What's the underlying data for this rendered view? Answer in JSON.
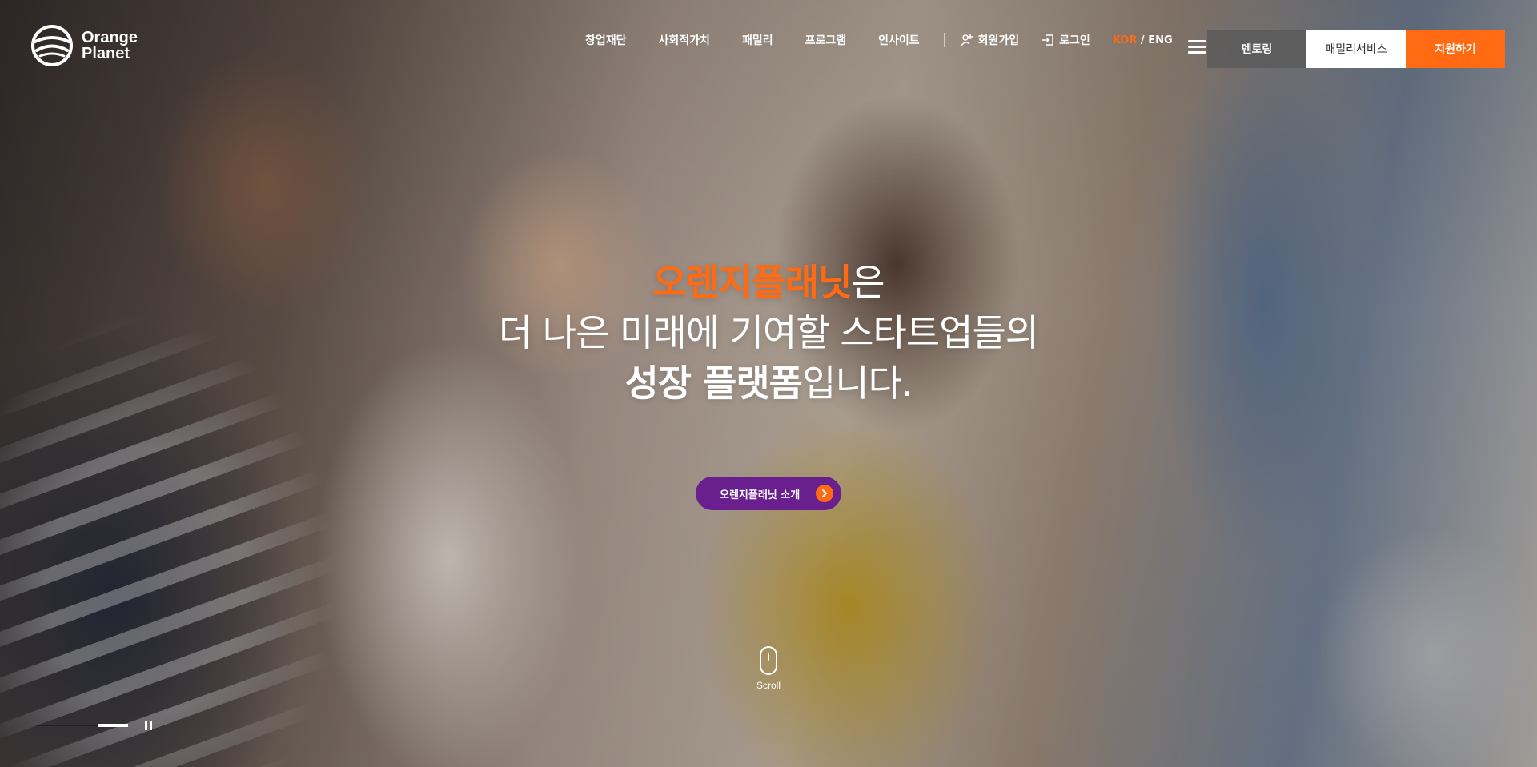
{
  "header": {
    "logo": {
      "line1": "Orange",
      "line2": "Planet"
    },
    "nav": [
      {
        "label": "창업재단"
      },
      {
        "label": "사회적가치"
      },
      {
        "label": "패밀리"
      },
      {
        "label": "프로그램"
      },
      {
        "label": "인사이트"
      }
    ],
    "signup_label": "회원가입",
    "login_label": "로그인",
    "lang_active": "KOR",
    "lang_separator": "/",
    "lang_other": "ENG",
    "menu_icon": "hamburger-menu-icon",
    "buttons": {
      "mentoring": "멘토링",
      "family_service": "패밀리서비스",
      "apply": "지원하기"
    }
  },
  "hero": {
    "headline": {
      "brand": "오렌지플래닛",
      "brand_suffix": "은",
      "line2": "더 나은 미래에 기여할 스타트업들의",
      "line3_bold": "성장 플랫폼",
      "line3_rest": "입니다."
    },
    "cta_label": "오렌지플래닛 소개",
    "scroll_label": "Scroll",
    "slide_progress": 0.33
  },
  "colors": {
    "brand_orange": "#ff6a13",
    "cta_purple": "#6a1f8e",
    "mentoring_bg": "#5a5a5a",
    "white": "#ffffff"
  }
}
